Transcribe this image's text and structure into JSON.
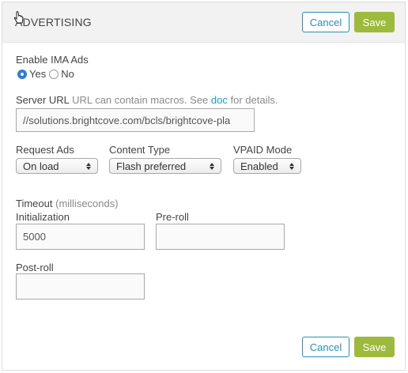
{
  "header": {
    "title": "ADVERTISING",
    "cancel_label": "Cancel",
    "save_label": "Save"
  },
  "ima": {
    "label": "Enable IMA Ads",
    "options": [
      {
        "label": "Yes",
        "checked": true
      },
      {
        "label": "No",
        "checked": false
      }
    ]
  },
  "server_url": {
    "label": "Server URL",
    "hint_before": "URL can contain macros. See",
    "link_text": "doc",
    "hint_after": "for details.",
    "value": "//solutions.brightcove.com/bcls/brightcove-pla"
  },
  "request_ads": {
    "label": "Request Ads",
    "value": "On load"
  },
  "content_type": {
    "label": "Content Type",
    "value": "Flash preferred"
  },
  "vpaid_mode": {
    "label": "VPAID Mode",
    "value": "Enabled"
  },
  "timeout": {
    "label": "Timeout",
    "unit": "(milliseconds)",
    "initialization": {
      "label": "Initialization",
      "value": "5000"
    },
    "preroll": {
      "label": "Pre-roll",
      "value": ""
    },
    "postroll": {
      "label": "Post-roll",
      "value": ""
    }
  },
  "footer": {
    "cancel_label": "Cancel",
    "save_label": "Save"
  },
  "colors": {
    "accent": "#2a8fb5",
    "save": "#9dba3d",
    "link": "#1f9bc7"
  }
}
